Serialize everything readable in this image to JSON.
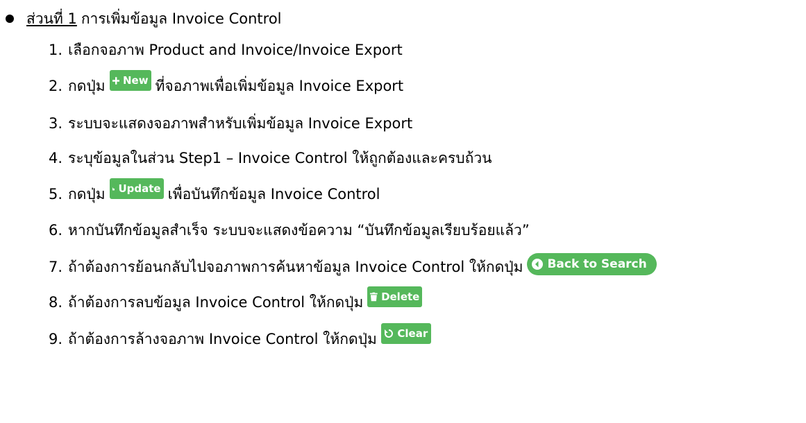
{
  "section": {
    "label": "ส่วนที่ 1",
    "title": "การเพิ่มข้อมูล Invoice Control"
  },
  "steps": [
    {
      "num": "1.",
      "before": "เลือกจอภาพ Product and Invoice/Invoice Export"
    },
    {
      "num": "2.",
      "before": "กดปุ่ม",
      "button": "New",
      "button_icon": "plus-icon",
      "after": "ที่จอภาพเพื่อเพิ่มข้อมูล Invoice Export"
    },
    {
      "num": "3.",
      "before": "ระบบจะแสดงจอภาพสำหรับเพิ่มข้อมูล Invoice Export"
    },
    {
      "num": "4.",
      "before": "ระบุข้อมูลในส่วน Step1 – Invoice Control ให้ถูกต้องและครบถ้วน"
    },
    {
      "num": "5.",
      "before": "กดปุ่ม",
      "button": "Update",
      "button_icon": "save-icon",
      "after": "เพื่อบันทึกข้อมูล Invoice Control"
    },
    {
      "num": "6.",
      "before": "หากบันทึกข้อมูลสำเร็จ ระบบจะแสดงข้อความ “บันทึกข้อมูลเรียบร้อยแล้ว”"
    },
    {
      "num": "7.",
      "before": "ถ้าต้องการย้อนกลับไปจอภาพการค้นหาข้อมูล Invoice Control ให้กดปุ่ม",
      "button": "Back to Search",
      "button_icon": "circle-left-arrow-icon"
    },
    {
      "num": "8.",
      "before": "ถ้าต้องการลบข้อมูล Invoice Control ให้กดปุ่ม",
      "button": "Delete",
      "button_icon": "trash-icon"
    },
    {
      "num": "9.",
      "before": "ถ้าต้องการล้างจอภาพ Invoice Control ให้กดปุ่ม",
      "button": "Clear",
      "button_icon": "refresh-icon"
    }
  ],
  "colors": {
    "button_green": "#55b85b",
    "text": "#000000"
  }
}
